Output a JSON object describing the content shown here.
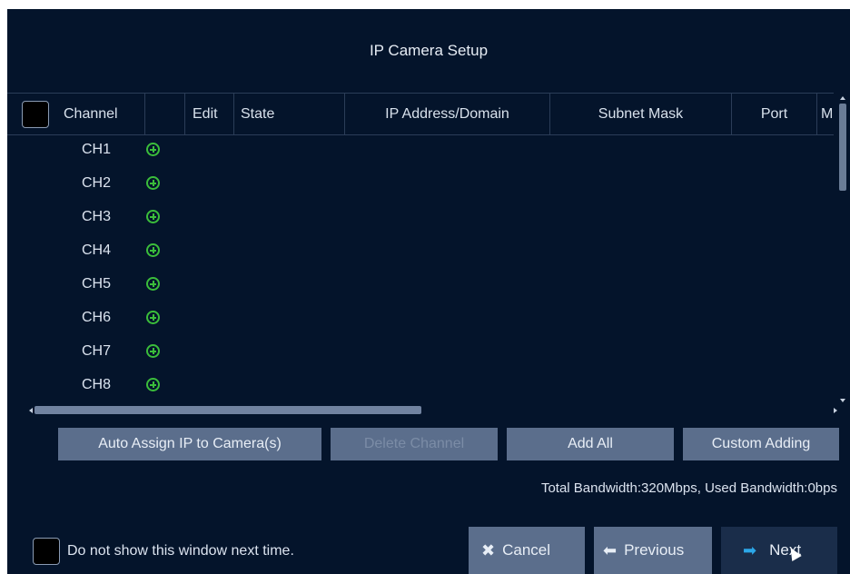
{
  "window": {
    "title": "IP Camera Setup"
  },
  "table": {
    "columns": [
      "Channel",
      "",
      "Edit",
      "State",
      "IP Address/Domain",
      "Subnet Mask",
      "Port",
      "M"
    ],
    "rows": [
      {
        "channel": "CH1"
      },
      {
        "channel": "CH2"
      },
      {
        "channel": "CH3"
      },
      {
        "channel": "CH4"
      },
      {
        "channel": "CH5"
      },
      {
        "channel": "CH6"
      },
      {
        "channel": "CH7"
      },
      {
        "channel": "CH8"
      }
    ],
    "add_icon": "plus-circle-icon",
    "add_icon_color": "#3bbd3b"
  },
  "buttons": {
    "auto_assign": "Auto Assign IP to Camera(s)",
    "delete_channel": "Delete Channel",
    "add_all": "Add All",
    "custom_adding": "Custom Adding"
  },
  "bandwidth_text": "Total Bandwidth:320Mbps, Used Bandwidth:0bps",
  "dont_show_label": "Do not show this window next time.",
  "nav": {
    "cancel": "Cancel",
    "cancel_icon": "close-x-icon",
    "previous": "Previous",
    "previous_icon": "arrow-left-icon",
    "next": "Next",
    "next_icon": "arrow-right-icon",
    "next_icon_color": "#2ca7e8"
  },
  "colors": {
    "background": "#04142b",
    "button": "#5b6e8c"
  }
}
